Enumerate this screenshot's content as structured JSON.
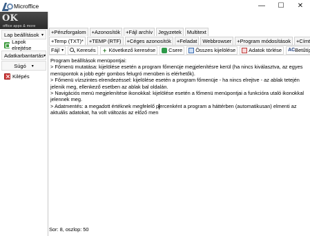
{
  "window": {
    "title": "Microffice",
    "controls": [
      "—",
      "☐",
      "✕"
    ]
  },
  "brand": {
    "mark": "OK",
    "subtitle": "office apps & more"
  },
  "sidebar": {
    "items": [
      {
        "label": "Lap beállítások",
        "caret": "▾"
      },
      {
        "label": "Lapok elrejtése",
        "caret": ""
      },
      {
        "label": "Adatkarbantartás",
        "caret": "▾"
      },
      {
        "label": "Súgó",
        "caret": "▾"
      },
      {
        "label": "Kilépés",
        "caret": ""
      }
    ]
  },
  "tabs": {
    "row1": [
      "+Pénzforgalom",
      "+Azonosítók",
      "+Fájl archív",
      "Jegyzetek",
      "Multitext"
    ],
    "row2": [
      "+Temp (TXT)*",
      "+TEMP (RTF)",
      "+Céges azonosítók",
      "+Feladat",
      "Webbrowser",
      "+Program módosítások",
      "+Címtár"
    ]
  },
  "toolbar": {
    "file_menu": "Fájl",
    "file_caret": "▾",
    "search": "Keresés",
    "next_search": "Következő keresése",
    "replace": "Csere",
    "select_all": "Összes kijelölése",
    "delete_data": "Adatok törlése",
    "font": "Betűtípus",
    "font_icon_text": "AC"
  },
  "editor": {
    "lines": [
      "Program beállítások menüpontjai:",
      "  >  Főmenü mutatása: kijelölése esetén a program főmenüje megjelenítésre kerül (ha nincs kiválasztva, az egyes menüpontok a jobb egér gombos felugró menüben is elérhetők).",
      "  >  Főmenü vízszintes elrendezéssel: kijelölése esetén a program főmenüje - ha nincs elrejtve - az ablak tetején jelenik meg, ellenkező esetben az ablak bal oldalán.",
      "  >  Navigációs menü megjelenítése ikonokkal: kijelölése esetén a főmenü menüpontjai a funkcióra utaló ikonokkal jelennek meg."
    ],
    "last_line_before_caret": "  >  Adatmentés: a megadott értéknek megfelelő p",
    "last_line_after_caret": "ercenként a program a háttérben (automatikusan) elmenti az aktuális adatokat, ha volt változás az előző men"
  },
  "status": {
    "text": "Sor: 8, oszlop: 50"
  }
}
